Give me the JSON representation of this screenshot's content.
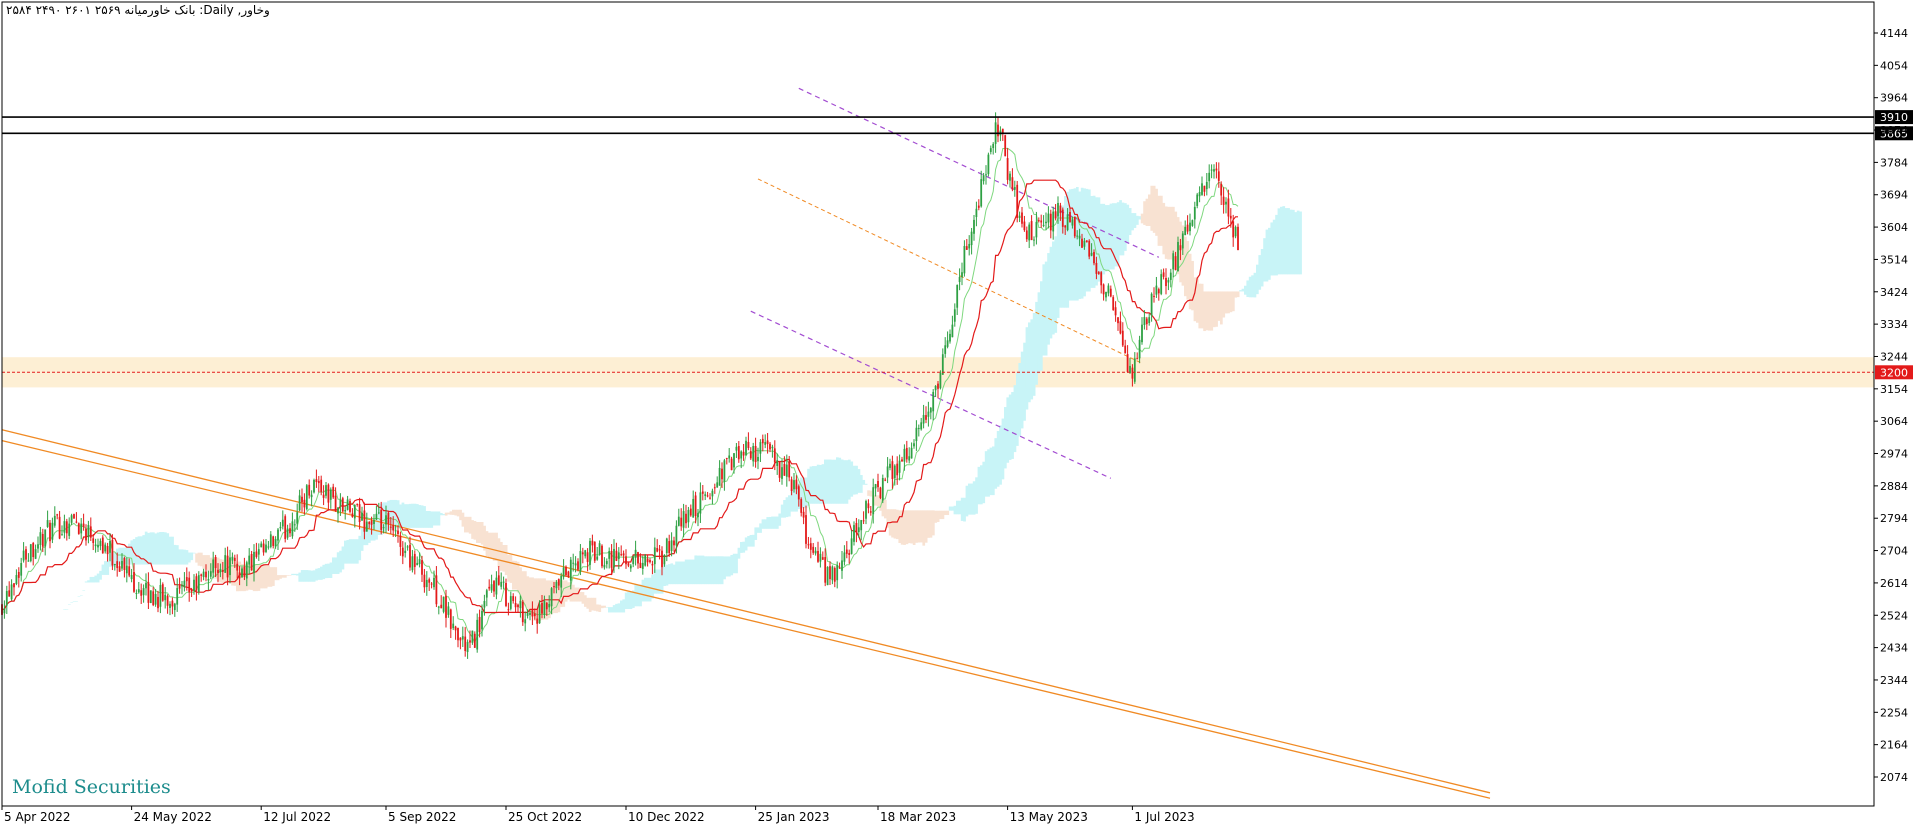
{
  "chart_data": {
    "type": "candlestick",
    "title": "بانک خاورمیانه ۲۵۶۹ ۲۶۰۱ ۲۴۹۰ ۲۵۸۴ :Daily ,وخاور",
    "watermark": "Mofid Securities",
    "y_ticks": [
      4144,
      4054,
      3964,
      3874,
      3784,
      3694,
      3604,
      3514,
      3424,
      3334,
      3244,
      3154,
      3064,
      2974,
      2884,
      2794,
      2704,
      2614,
      2524,
      2434,
      2344,
      2254,
      2164,
      2074
    ],
    "y_tick_labels": [
      "4144",
      "4054",
      "3964",
      "3874",
      "3784",
      "3694",
      "3604",
      "3514",
      "3424",
      "3334",
      "3244",
      "3154",
      "3064",
      "2974",
      "2884",
      "2794",
      "2704",
      "2614",
      "2524",
      "2434",
      "2344",
      "2254",
      "2164",
      "2074"
    ],
    "ylim": [
      1985,
      4218
    ],
    "x_labels": [
      "5 Apr 2022",
      "24 May 2022",
      "12 Jul 2022",
      "5 Sep 2022",
      "25 Oct 2022",
      "10 Dec 2022",
      "25 Jan 2023",
      "18 Mar 2023",
      "13 May 2023",
      "1 Jul 2023"
    ],
    "price_levels": [
      {
        "label": "3910",
        "value": 3910,
        "style": "solid",
        "color": "#000000"
      },
      {
        "label": "3865",
        "value": 3865,
        "style": "solid",
        "color": "#000000"
      },
      {
        "label": "3200",
        "value": 3200,
        "style": "dashed",
        "color": "#e31a1a"
      }
    ],
    "support_zone": {
      "from": 3158,
      "to": 3242,
      "color": "#fdefd4"
    },
    "colors": {
      "bull": "#2ea043",
      "bear": "#e31a1a",
      "kijun": "#e31a1a",
      "tenkan": "#7fd87f",
      "cloud_bull": "#c8f4f7",
      "cloud_bear": "#f8e2d2",
      "trend": "#f08a24",
      "channel": "#a24bd1"
    },
    "close_series_anchors": [
      [
        0,
        2560
      ],
      [
        10,
        2700
      ],
      [
        20,
        2760
      ],
      [
        30,
        2790
      ],
      [
        40,
        2740
      ],
      [
        50,
        2660
      ],
      [
        60,
        2580
      ],
      [
        70,
        2570
      ],
      [
        80,
        2600
      ],
      [
        90,
        2670
      ],
      [
        100,
        2650
      ],
      [
        110,
        2700
      ],
      [
        120,
        2780
      ],
      [
        130,
        2900
      ],
      [
        140,
        2830
      ],
      [
        150,
        2790
      ],
      [
        160,
        2770
      ],
      [
        170,
        2690
      ],
      [
        180,
        2600
      ],
      [
        190,
        2460
      ],
      [
        195,
        2430
      ],
      [
        205,
        2620
      ],
      [
        215,
        2540
      ],
      [
        225,
        2520
      ],
      [
        235,
        2640
      ],
      [
        245,
        2700
      ],
      [
        255,
        2690
      ],
      [
        265,
        2680
      ],
      [
        275,
        2680
      ],
      [
        285,
        2800
      ],
      [
        295,
        2860
      ],
      [
        300,
        2930
      ],
      [
        310,
        2980
      ],
      [
        320,
        2980
      ],
      [
        330,
        2880
      ],
      [
        335,
        2740
      ],
      [
        340,
        2680
      ],
      [
        345,
        2620
      ],
      [
        350,
        2660
      ],
      [
        360,
        2820
      ],
      [
        370,
        2920
      ],
      [
        380,
        3000
      ],
      [
        390,
        3150
      ],
      [
        400,
        3500
      ],
      [
        410,
        3760
      ],
      [
        415,
        3890
      ],
      [
        420,
        3740
      ],
      [
        425,
        3600
      ],
      [
        430,
        3580
      ],
      [
        440,
        3640
      ],
      [
        450,
        3560
      ],
      [
        460,
        3440
      ],
      [
        465,
        3320
      ],
      [
        470,
        3190
      ],
      [
        480,
        3410
      ],
      [
        490,
        3530
      ],
      [
        500,
        3700
      ],
      [
        505,
        3760
      ],
      [
        510,
        3640
      ],
      [
        515,
        3560
      ]
    ]
  }
}
